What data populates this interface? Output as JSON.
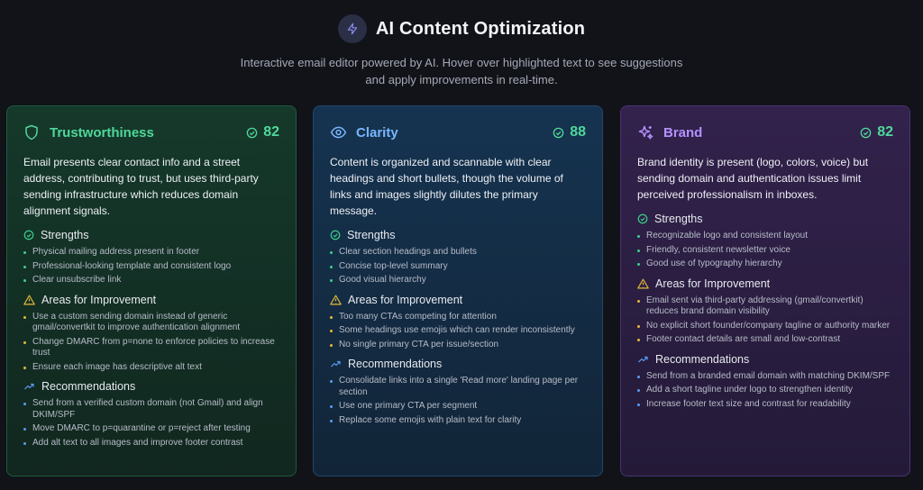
{
  "header": {
    "icon": "lightning-icon",
    "title": "AI Content Optimization",
    "subtitle_line1": "Interactive email editor powered by AI. Hover over highlighted text to see suggestions",
    "subtitle_line2": "and apply improvements in real-time."
  },
  "colors": {
    "background": "#111318",
    "trust_accent": "#4fd89a",
    "clarity_accent": "#78b6ff",
    "brand_accent": "#b591ff",
    "strength_bullet": "#3ccf8a",
    "improve_bullet": "#e6b93a",
    "rec_bullet": "#5b9cf5"
  },
  "section_labels": {
    "strengths": "Strengths",
    "improvements": "Areas for Improvement",
    "recommendations": "Recommendations"
  },
  "cards": {
    "trust": {
      "icon": "shield-icon",
      "title": "Trustworthiness",
      "score": "82",
      "summary": "Email presents clear contact info and a street address, contributing to trust, but uses third-party sending infrastructure which reduces domain alignment signals.",
      "strengths": [
        "Physical mailing address present in footer",
        "Professional-looking template and consistent logo",
        "Clear unsubscribe link"
      ],
      "improvements": [
        "Use a custom sending domain instead of generic gmail/convertkit to improve authentication alignment",
        "Change DMARC from p=none to enforce policies to increase trust",
        "Ensure each image has descriptive alt text"
      ],
      "recommendations": [
        "Send from a verified custom domain (not Gmail) and align DKIM/SPF",
        "Move DMARC to p=quarantine or p=reject after testing",
        "Add alt text to all images and improve footer contrast"
      ]
    },
    "clarity": {
      "icon": "eye-icon",
      "title": "Clarity",
      "score": "88",
      "summary": "Content is organized and scannable with clear headings and short bullets, though the volume of links and images slightly dilutes the primary message.",
      "strengths": [
        "Clear section headings and bullets",
        "Concise top-level summary",
        "Good visual hierarchy"
      ],
      "improvements": [
        "Too many CTAs competing for attention",
        "Some headings use emojis which can render inconsistently",
        "No single primary CTA per issue/section"
      ],
      "recommendations": [
        "Consolidate links into a single 'Read more' landing page per section",
        "Use one primary CTA per segment",
        "Replace some emojis with plain text for clarity"
      ]
    },
    "brand": {
      "icon": "sparkles-icon",
      "title": "Brand",
      "score": "82",
      "summary": "Brand identity is present (logo, colors, voice) but sending domain and authentication issues limit perceived professionalism in inboxes.",
      "strengths": [
        "Recognizable logo and consistent layout",
        "Friendly, consistent newsletter voice",
        "Good use of typography hierarchy"
      ],
      "improvements": [
        "Email sent via third-party addressing (gmail/convertkit) reduces brand domain visibility",
        "No explicit short founder/company tagline or authority marker",
        "Footer contact details are small and low-contrast"
      ],
      "recommendations": [
        "Send from a branded email domain with matching DKIM/SPF",
        "Add a short tagline under logo to strengthen identity",
        "Increase footer text size and contrast for readability"
      ]
    }
  }
}
